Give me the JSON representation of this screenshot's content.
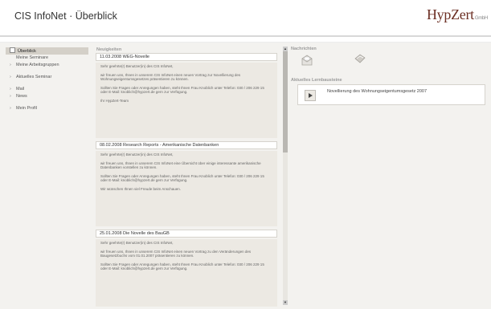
{
  "app": {
    "title": "CIS InfoNet · Überblick",
    "logo": "HypZert",
    "logo_suffix": "GmbH"
  },
  "sidebar": {
    "items": [
      {
        "label": "Überblick",
        "active": true
      },
      {
        "label": "Meine Seminare"
      },
      {
        "label": "Meine Arbeitsgruppen"
      },
      {
        "label": "Aktuelles Seminar"
      },
      {
        "label": "Mail"
      },
      {
        "label": "News"
      },
      {
        "label": "Mein Profil"
      }
    ]
  },
  "news": {
    "title": "Neuigkeiten",
    "items": [
      {
        "head": "11.03.2008   WEG-Novelle",
        "paragraphs": [
          "Sehr geehrte(r) Benutzer(in) des CIS InfoNet,",
          "wir freuen uns, Ihnen in unserem CIS InfoNet einen neuen Vortrag zur Novellierung des Wohnungseigentumsgesetzes präsentieren zu können.",
          "Sollten Sie Fragen oder Anregungen haben, steht Ihnen Frau Knoblich unter Telefon: 030 / 206 229 15 oder E-Mail: knoblich@hypzert.de gern zur Verfügung.",
          "Ihr HypZert-Team"
        ]
      },
      {
        "head": "08.02.2008   Research Reports - Amerikanische Datenbanken",
        "paragraphs": [
          "Sehr geehrte(r) Benutzer(in) des CIS InfoNet,",
          "wir freuen uns, Ihnen in unserem CIS InfoNet eine Übersicht über einige interessante amerikanische Datenbanken vorstellen zu können.",
          "Sollten Sie Fragen oder Anregungen haben, steht Ihnen Frau Knoblich unter Telefon: 030 / 206 229 15 oder E-Mail: knoblich@hypzert.de gern zur Verfügung.",
          "Wir wünschen Ihnen viel Freude beim Anschauen."
        ]
      },
      {
        "head": "25.01.2008   Die Novelle des BauGB",
        "paragraphs": [
          "Sehr geehrte(r) Benutzer(in) des CIS InfoNet,",
          "wir freuen uns, Ihnen in unserem CIS InfoNet einen neuen Vortrag zu den Veränderungen des Baugesetzbuchs vom 01.01.2007 präsentieren zu können.",
          "Sollten Sie Fragen oder Anregungen haben, steht Ihnen Frau Knoblich unter Telefon: 030 / 206 229 15 oder E-Mail: knoblich@hypzert.de gern zur Verfügung."
        ]
      }
    ]
  },
  "notices": {
    "title": "Nachrichten"
  },
  "library": {
    "title": "Aktuelles Lernbausteine",
    "items": [
      {
        "label": "Novellierung des Wohnungseigentumsgesetz 2007"
      }
    ]
  }
}
